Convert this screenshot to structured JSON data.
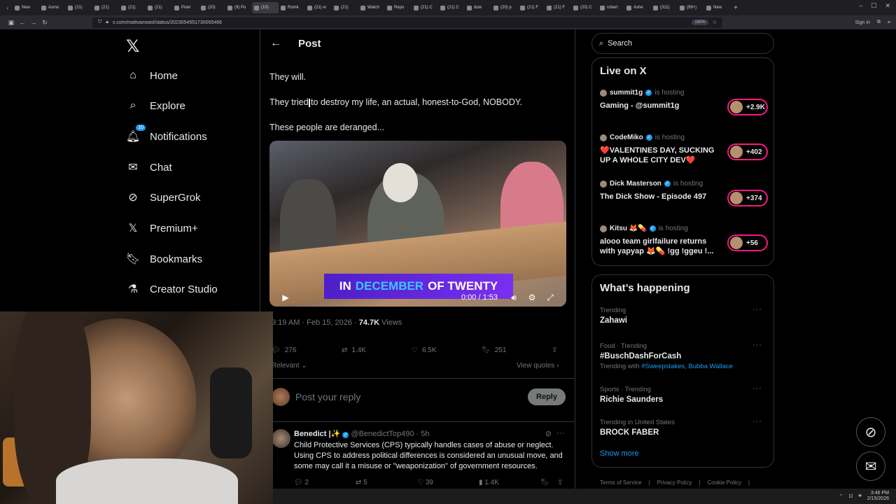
{
  "browser": {
    "tabs": [
      "New",
      "Asmo",
      "(21)",
      "(21)",
      "(21)",
      "(21)",
      "Pixel",
      "(20)",
      "(9) Po",
      "(10)",
      "Romk",
      "(21) w",
      "(21)",
      "Watch",
      "Repo",
      "(21) C",
      "(21) C",
      "dow",
      "(20) p",
      "(21) F",
      "(21) F",
      "(20) C",
      "robert",
      "Ashe",
      "(311)",
      "(99+)",
      "New"
    ],
    "url": "x.com/mattvanswol/status/2023054551730065466",
    "zoom": "150%",
    "signin": "Sign in"
  },
  "nav": {
    "items": [
      {
        "label": "Home",
        "icon": "home-icon"
      },
      {
        "label": "Explore",
        "icon": "search-icon"
      },
      {
        "label": "Notifications",
        "icon": "bell-icon",
        "badge": "10"
      },
      {
        "label": "Chat",
        "icon": "mail-icon"
      },
      {
        "label": "SuperGrok",
        "icon": "grok-icon"
      },
      {
        "label": "Premium+",
        "icon": "x-icon"
      },
      {
        "label": "Bookmarks",
        "icon": "bookmark-icon"
      },
      {
        "label": "Creator Studio",
        "icon": "flask-icon"
      }
    ]
  },
  "post": {
    "header": "Post",
    "lines": [
      "They will.",
      "They tried to destroy my life, an actual, honest-to-God, NOBODY.",
      "These people are deranged..."
    ],
    "video": {
      "caption_a": "IN",
      "caption_b": "DECEMBER",
      "caption_c": "OF TWENTY",
      "time": "0:00 / 1:53"
    },
    "meta_time": "9:19 AM · Feb 15, 2026 · ",
    "views": "74.7K",
    "views_label": " Views",
    "replies": "276",
    "reposts": "1.4K",
    "likes": "6.5K",
    "bookmarks": "251",
    "relevant": "Relevant",
    "view_quotes": "View quotes",
    "reply_placeholder": "Post your reply",
    "reply_button": "Reply"
  },
  "reply": {
    "name": "Benedict |✨",
    "handle": "@BenedictTop490 · 5h",
    "body": "Child Protective Services (CPS) typically handles cases of abuse or neglect. Using CPS to address political differences is considered an unusual move, and some may call it a misuse or \"weaponization\" of government resources.",
    "replies": "2",
    "reposts": "5",
    "likes": "39",
    "views": "1.4K"
  },
  "search": {
    "placeholder": "Search"
  },
  "live": {
    "title": "Live on X",
    "items": [
      {
        "host": "summit1g",
        "hosting": "is hosting",
        "title": "Gaming - @summit1g",
        "count": "+2.9K"
      },
      {
        "host": "CodeMiko",
        "hosting": "is hosting",
        "title": "❤️VALENTINES DAY, SUCKING UP A WHOLE CITY DEV❤️",
        "count": "+402"
      },
      {
        "host": "Dick Masterson",
        "hosting": "is hosting",
        "title": "The Dick Show - Episode 497",
        "count": "+374"
      },
      {
        "host": "Kitsu 🦊💊",
        "hosting": "is hosting",
        "title": "alooo team girlfailure returns with yapyap 🦊💊 !gg !ggeu !...",
        "count": "+56"
      }
    ]
  },
  "happening": {
    "title": "What’s happening",
    "items": [
      {
        "category": "Trending",
        "name": "Zahawi",
        "sub": ""
      },
      {
        "category": "Food · Trending",
        "name": "#BuschDashForCash",
        "sub_prefix": "Trending with ",
        "sub_links": "#Sweepstakes, Bubba Wallace"
      },
      {
        "category": "Sports · Trending",
        "name": "Richie Saunders",
        "sub": ""
      },
      {
        "category": "Trending in United States",
        "name": "BROCK FABER",
        "sub": ""
      }
    ],
    "show_more": "Show more"
  },
  "footer": [
    "Terms of Service",
    "Privacy Policy",
    "Cookie Policy"
  ],
  "taskbar": {
    "time": "3:46 PM",
    "date": "2/15/2026"
  }
}
